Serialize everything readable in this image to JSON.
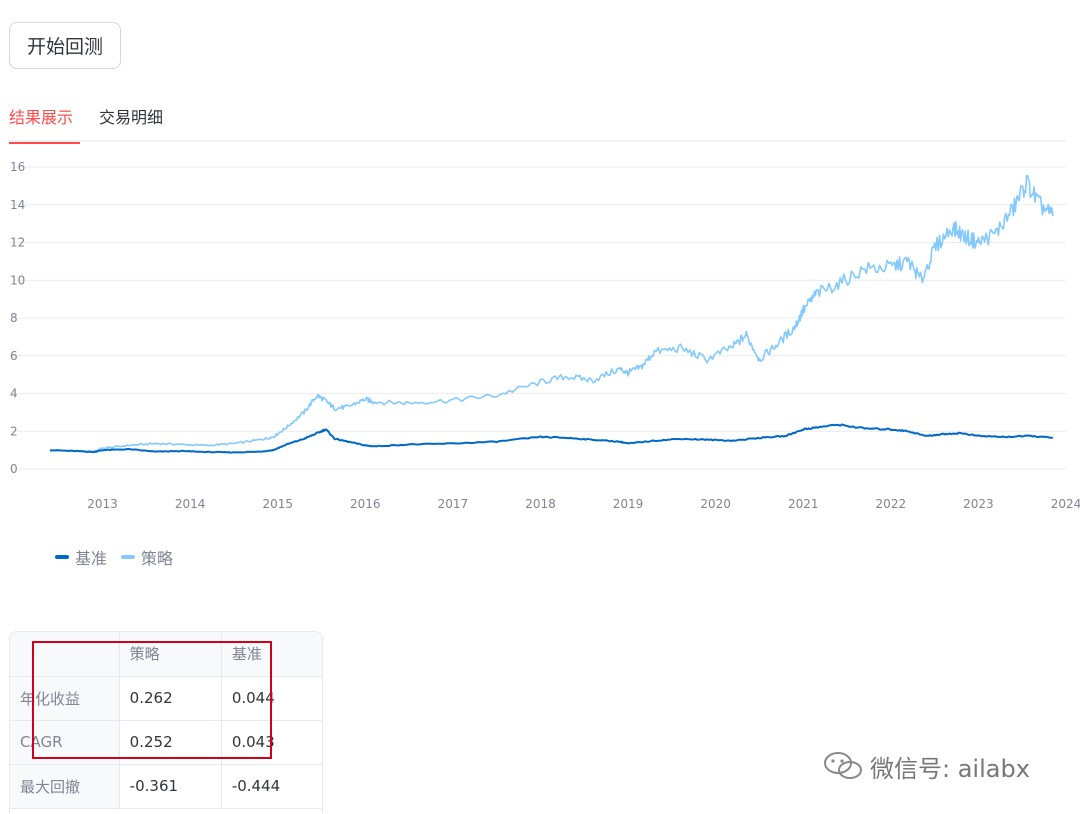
{
  "run_button": {
    "label": "开始回测"
  },
  "tabs": [
    {
      "label": "结果展示",
      "active": true
    },
    {
      "label": "交易明细",
      "active": false
    }
  ],
  "chart_data": {
    "type": "line",
    "x_ticks": [
      "2013",
      "2014",
      "2015",
      "2016",
      "2017",
      "2018",
      "2019",
      "2020",
      "2021",
      "2022",
      "2023",
      "2024"
    ],
    "y_ticks": [
      "0",
      "2",
      "4",
      "6",
      "8",
      "10",
      "12",
      "14",
      "16"
    ],
    "ylim": [
      0,
      16
    ],
    "xlim": [
      2012.4,
      2024.0
    ],
    "grid": true,
    "legend_position": "bottom-left",
    "series": [
      {
        "name": "基准",
        "color": "#0068c9",
        "x": [
          2012.4,
          2012.7,
          2012.9,
          2013.0,
          2013.3,
          2013.6,
          2013.9,
          2014.2,
          2014.5,
          2014.8,
          2014.95,
          2015.1,
          2015.3,
          2015.45,
          2015.55,
          2015.65,
          2015.8,
          2016.0,
          2016.1,
          2016.5,
          2017.0,
          2017.5,
          2018.0,
          2018.3,
          2018.6,
          2018.9,
          2019.0,
          2019.3,
          2019.6,
          2019.9,
          2020.2,
          2020.5,
          2020.8,
          2021.0,
          2021.15,
          2021.4,
          2021.7,
          2022.0,
          2022.2,
          2022.4,
          2022.6,
          2022.8,
          2023.0,
          2023.3,
          2023.6,
          2023.85
        ],
        "values": [
          1.0,
          0.95,
          0.9,
          1.0,
          1.05,
          0.92,
          0.95,
          0.9,
          0.88,
          0.92,
          1.0,
          1.3,
          1.6,
          1.9,
          2.1,
          1.6,
          1.45,
          1.25,
          1.2,
          1.3,
          1.35,
          1.45,
          1.7,
          1.65,
          1.55,
          1.45,
          1.35,
          1.5,
          1.6,
          1.55,
          1.5,
          1.65,
          1.75,
          2.1,
          2.2,
          2.35,
          2.15,
          2.1,
          2.0,
          1.75,
          1.85,
          1.9,
          1.75,
          1.7,
          1.75,
          1.65
        ]
      },
      {
        "name": "策略",
        "color": "#83c9ff",
        "x": [
          2012.4,
          2012.7,
          2012.9,
          2013.0,
          2013.3,
          2013.6,
          2013.9,
          2014.2,
          2014.5,
          2014.8,
          2014.95,
          2015.1,
          2015.3,
          2015.45,
          2015.55,
          2015.65,
          2015.8,
          2016.0,
          2016.1,
          2016.5,
          2017.0,
          2017.5,
          2018.0,
          2018.3,
          2018.6,
          2018.9,
          2019.0,
          2019.15,
          2019.3,
          2019.6,
          2019.9,
          2020.2,
          2020.35,
          2020.5,
          2020.7,
          2020.9,
          2021.0,
          2021.15,
          2021.4,
          2021.7,
          2022.0,
          2022.2,
          2022.35,
          2022.5,
          2022.7,
          2022.85,
          2023.0,
          2023.2,
          2023.4,
          2023.55,
          2023.7,
          2023.85
        ],
        "values": [
          1.0,
          0.95,
          0.92,
          1.1,
          1.25,
          1.35,
          1.3,
          1.25,
          1.35,
          1.55,
          1.7,
          2.2,
          3.0,
          3.9,
          3.6,
          3.2,
          3.3,
          3.7,
          3.55,
          3.5,
          3.65,
          3.9,
          4.6,
          4.9,
          4.7,
          5.3,
          5.1,
          5.4,
          6.2,
          6.4,
          5.8,
          6.5,
          7.1,
          5.8,
          6.6,
          7.5,
          8.4,
          9.3,
          9.8,
          10.6,
          10.7,
          11.0,
          10.0,
          11.7,
          12.8,
          12.3,
          12.0,
          12.5,
          13.8,
          15.2,
          14.0,
          13.4
        ]
      }
    ]
  },
  "metrics_table": {
    "columns": [
      "",
      "策略",
      "基准"
    ],
    "rows": [
      {
        "label": "年化收益",
        "strategy": "0.262",
        "benchmark": "0.044"
      },
      {
        "label": "CAGR",
        "strategy": "0.252",
        "benchmark": "0.043"
      },
      {
        "label": "最大回撤",
        "strategy": "-0.361",
        "benchmark": "-0.444"
      }
    ]
  },
  "watermark": {
    "text": "微信号: ailabx"
  }
}
